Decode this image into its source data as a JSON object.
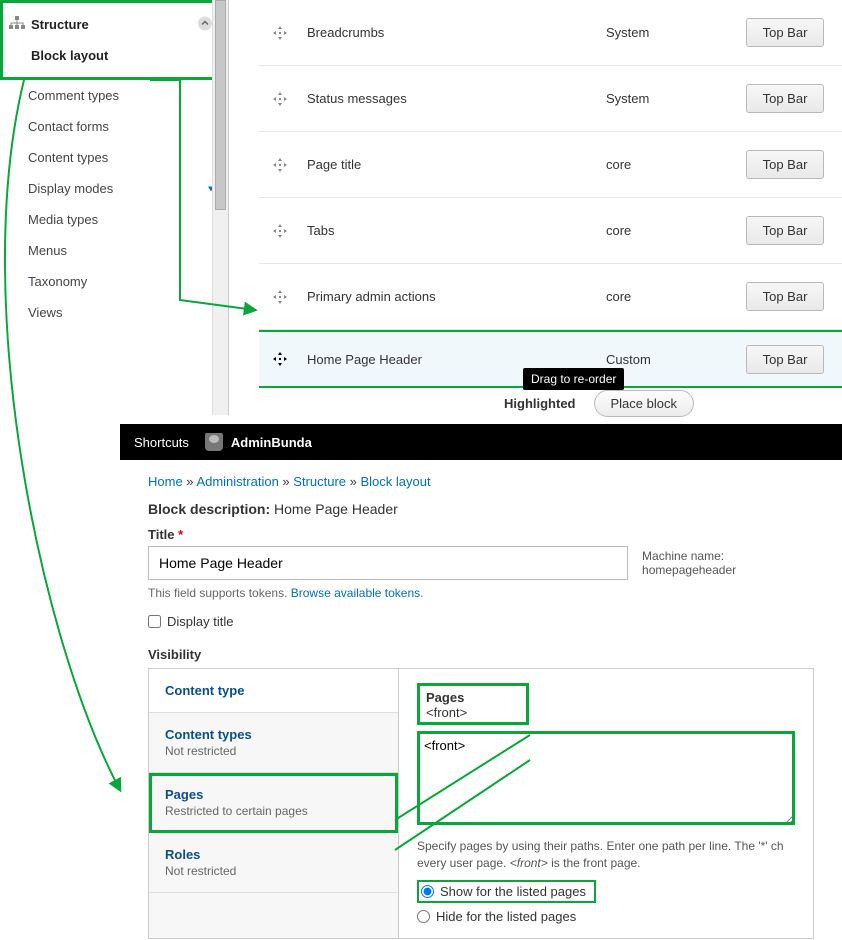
{
  "sidebar": {
    "highlighted": [
      "Structure",
      "Block layout"
    ],
    "items": [
      "Comment types",
      "Contact forms",
      "Content types",
      "Display modes",
      "Media types",
      "Menus",
      "Taxonomy",
      "Views"
    ],
    "expand_index": 3
  },
  "blocks": {
    "rows": [
      {
        "name": "Breadcrumbs",
        "cat": "System",
        "btn": "Top Bar"
      },
      {
        "name": "Status messages",
        "cat": "System",
        "btn": "Top Bar"
      },
      {
        "name": "Page title",
        "cat": "core",
        "btn": "Top Bar"
      },
      {
        "name": "Tabs",
        "cat": "core",
        "btn": "Top Bar"
      },
      {
        "name": "Primary admin actions",
        "cat": "core",
        "btn": "Top Bar"
      },
      {
        "name": "Home Page Header",
        "cat": "Custom",
        "btn": "Top Bar"
      }
    ],
    "tooltip": "Drag to re-order",
    "section_label": "Highlighted",
    "place_btn": "Place block"
  },
  "toolbar": {
    "shortcuts": "Shortcuts",
    "user": "AdminBunda"
  },
  "breadcrumbs": [
    "Home",
    "Administration",
    "Structure",
    "Block layout"
  ],
  "block_desc": {
    "label": "Block description:",
    "value": "Home Page Header"
  },
  "form": {
    "title_label": "Title",
    "title_value": "Home Page Header",
    "machine_label": "Machine name:",
    "machine_value": "homepageheader",
    "tokens_help": "This field supports tokens.",
    "tokens_link": "Browse available tokens.",
    "display_title": "Display title",
    "visibility": "Visibility"
  },
  "vtabs": [
    {
      "title": "Content type",
      "sub": ""
    },
    {
      "title": "Content types",
      "sub": "Not restricted"
    },
    {
      "title": "Pages",
      "sub": "Restricted to certain pages"
    },
    {
      "title": "Roles",
      "sub": "Not restricted"
    }
  ],
  "pages_pane": {
    "heading": "Pages",
    "value": "<front>",
    "help_a": "Specify pages by using their paths. Enter one path per line. The '*' ch",
    "help_b": "every user page.",
    "help_c": "<front>",
    "help_d": "is the front page.",
    "radio_show": "Show for the listed pages",
    "radio_hide": "Hide for the listed pages"
  }
}
